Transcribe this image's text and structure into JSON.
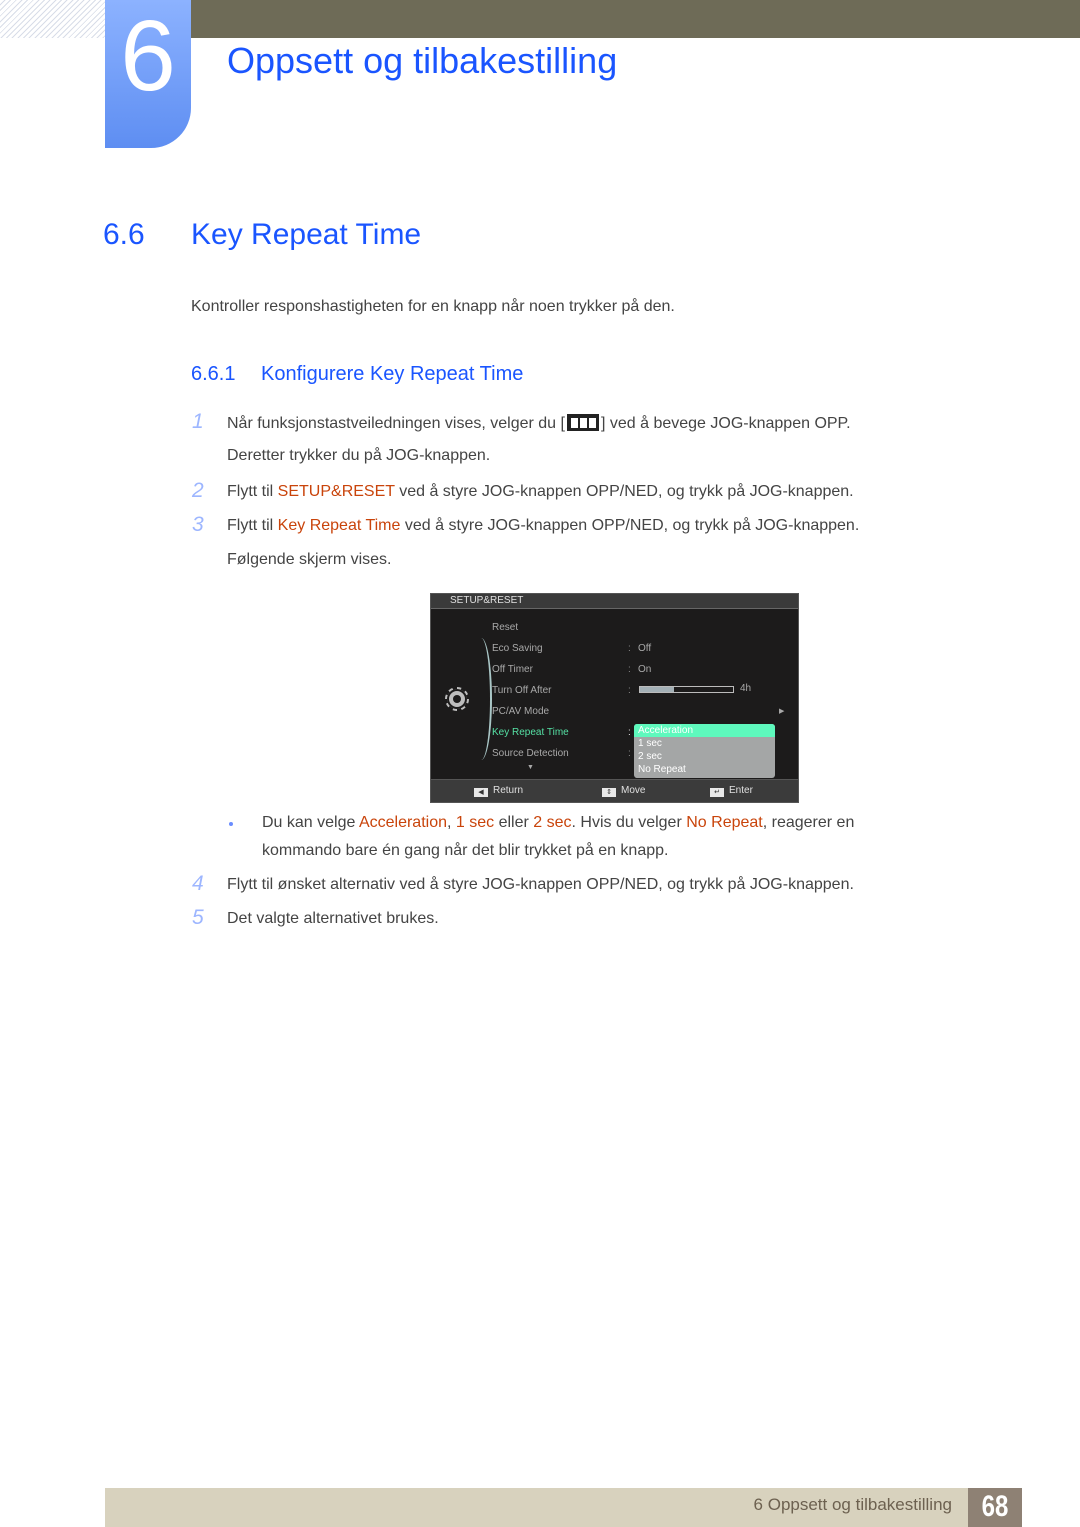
{
  "header": {
    "chapter_number": "6",
    "chapter_title": "Oppsett og tilbakestilling"
  },
  "section": {
    "number": "6.6",
    "title": "Key Repeat Time",
    "intro": "Kontroller responshastigheten for en knapp når noen trykker på den."
  },
  "subsection": {
    "number": "6.6.1",
    "title": "Konfigurere Key Repeat Time"
  },
  "steps": [
    {
      "num": "1",
      "pre": "Når funksjonstastveiledningen vises, velger du [",
      "icon": "menu-icon",
      "post": "] ved å bevege JOG-knappen OPP.",
      "line2": "Deretter trykker du på JOG-knappen."
    },
    {
      "num": "2",
      "pre": "Flytt til ",
      "hl": "SETUP&RESET",
      "post": " ved å styre JOG-knappen OPP/NED, og trykk på JOG-knappen."
    },
    {
      "num": "3",
      "pre": "Flytt til ",
      "hl": "Key Repeat Time",
      "post": " ved å styre JOG-knappen OPP/NED, og trykk på JOG-knappen.",
      "line2": "Følgende skjerm vises."
    },
    {
      "num": "4",
      "text": "Flytt til ønsket alternativ ved å styre JOG-knappen OPP/NED, og trykk på JOG-knappen."
    },
    {
      "num": "5",
      "text": "Det valgte alternativet brukes."
    }
  ],
  "note": {
    "t1": "Du kan velge ",
    "h1": "Acceleration",
    "t2": ", ",
    "h2": "1 sec",
    "t3": " eller ",
    "h3": "2 sec",
    "t4": ". Hvis du velger ",
    "h4": "No Repeat",
    "t5": ", reagerer en",
    "line2": "kommando bare én gang når det blir trykket på en knapp."
  },
  "osd": {
    "title": "SETUP&RESET",
    "items": [
      {
        "label": "Reset",
        "value": ""
      },
      {
        "label": "Eco Saving",
        "value": "Off"
      },
      {
        "label": "Off Timer",
        "value": "On"
      },
      {
        "label": "Turn Off After",
        "value": "4h",
        "progress": 0.37
      },
      {
        "label": "PC/AV Mode",
        "value": ""
      },
      {
        "label": "Key Repeat Time",
        "value": "",
        "active": true
      },
      {
        "label": "Source Detection",
        "value": ""
      }
    ],
    "dropdown_options": [
      "Acceleration",
      "1 sec",
      "2 sec",
      "No Repeat"
    ],
    "selected_option": "Acceleration",
    "footer": {
      "return": "Return",
      "move": "Move",
      "enter": "Enter"
    },
    "colors": {
      "active": "#55e0a4",
      "selected_bg": "#5ef9bd"
    }
  },
  "footer": {
    "chapter_label": "6 Oppsett og tilbakestilling",
    "page_number": "68"
  },
  "colors": {
    "heading_blue": "#1a55ff",
    "highlight_orange": "#c9440b",
    "top_bar": "#6e6b57",
    "footer_bg": "#d8d2be",
    "page_box": "#8e8174"
  }
}
